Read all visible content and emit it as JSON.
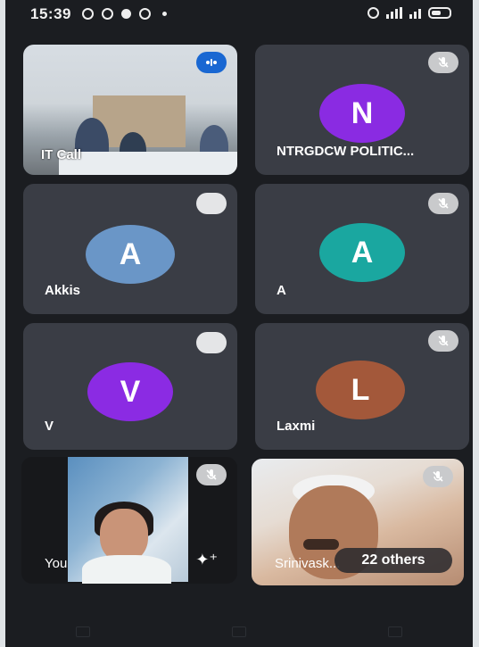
{
  "status_bar": {
    "time": "15:39",
    "right_text": "ଓ ⅏ ⁴ᴳ"
  },
  "tiles": [
    {
      "name": "IT Call",
      "kind": "video",
      "badge": "active"
    },
    {
      "name": "NTRGDCW POLITIC...",
      "initial": "N",
      "avatar_color": "#8a2be2",
      "badge": "mute"
    },
    {
      "name": "Akkis",
      "initial": "A",
      "avatar_color": "#6a96c7",
      "badge": "plain"
    },
    {
      "name": "A",
      "initial": "A",
      "avatar_color": "#1aa7a0",
      "badge": "mute"
    },
    {
      "name": "V",
      "initial": "V",
      "avatar_color": "#8b2be3",
      "badge": "plain"
    },
    {
      "name": "Laxmi",
      "initial": "L",
      "avatar_color": "#a3583a",
      "badge": "mute"
    },
    {
      "name": "You",
      "kind": "video",
      "badge": "mute"
    },
    {
      "name": "Srinivask...",
      "kind": "video",
      "badge": "mute",
      "others": "22 others"
    }
  ]
}
